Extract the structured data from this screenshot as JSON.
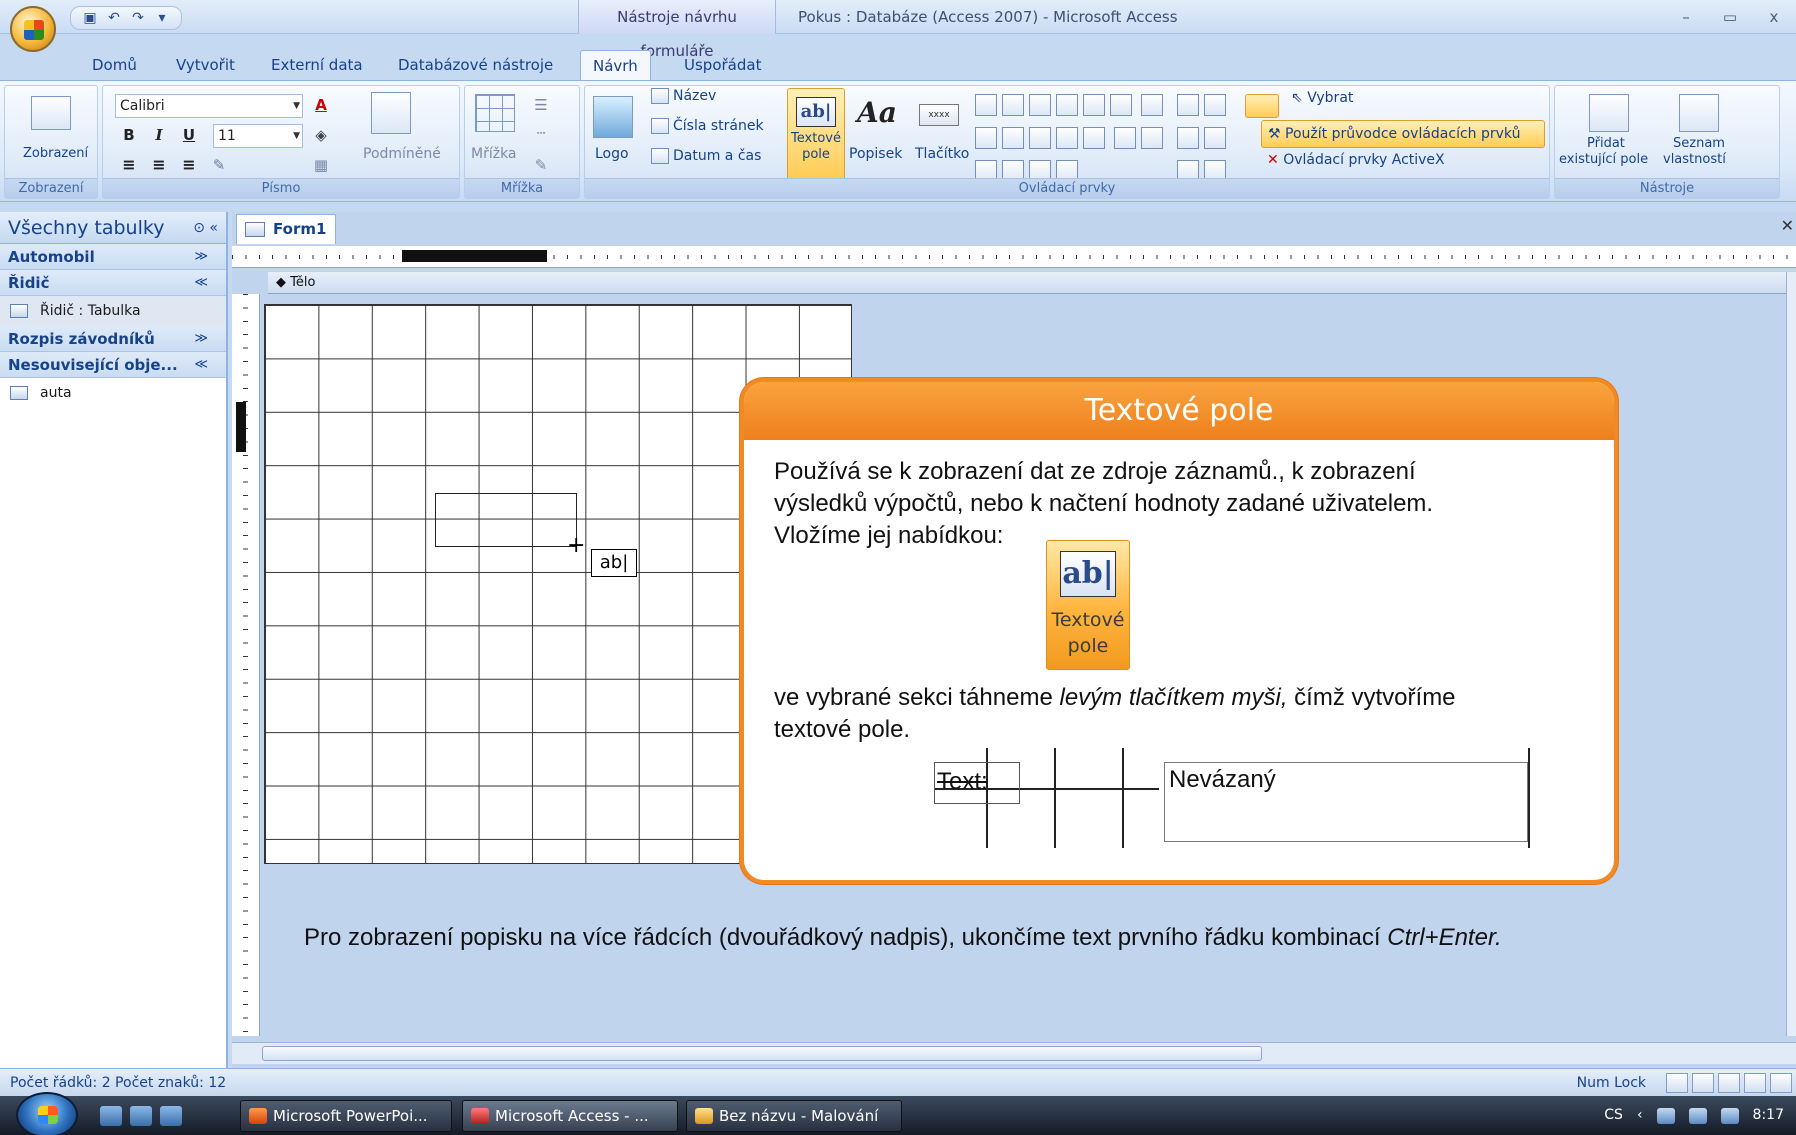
{
  "titlebar": {
    "context_tab_title": "Nástroje návrhu formuláře",
    "app_title": "Pokus : Databáze (Access 2007) - Microsoft Access",
    "minimize": "–",
    "maximize": "▭",
    "close": "x",
    "qat": {
      "save_icon": "floppy-icon",
      "undo_icon": "undo-icon",
      "redo_icon": "redo-icon",
      "customize_icon": "dropdown-icon"
    }
  },
  "ribbon_tabs": [
    "Domů",
    "Vytvořit",
    "Externí data",
    "Databázové nástroje",
    "Návrh",
    "Uspořádat"
  ],
  "ribbon": {
    "groups": {
      "zobrazeni": {
        "label": "Zobrazení",
        "button": "Zobrazení"
      },
      "pismo": {
        "label": "Písmo",
        "font": "Calibri",
        "size": "11",
        "bold": "B",
        "italic": "I",
        "underline": "U",
        "conditional": "Podmíněné"
      },
      "mrizka": {
        "label": "Mřížka",
        "button": "Mřížka"
      },
      "controls": {
        "label": "Ovládací prvky",
        "logo": "Logo",
        "nazev": "Název",
        "cisla_stranek": "Čísla stránek",
        "datum_cas": "Datum a čas",
        "textove_pole_l1": "Textové",
        "textove_pole_l2": "pole",
        "textbox_glyph": "ab|",
        "popisek": "Popisek",
        "popisek_glyph": "Aa",
        "tlacitko": "Tlačítko",
        "tlacitko_glyph": "xxxx",
        "vybrat": "Vybrat",
        "pruvodce": "Použít průvodce ovládacích prvků",
        "activex": "Ovládací prvky ActiveX"
      },
      "nastroje": {
        "label": "Nástroje",
        "pridat_l1": "Přidat",
        "pridat_l2": "existující pole",
        "seznam_l1": "Seznam",
        "seznam_l2": "vlastností"
      }
    }
  },
  "navpane": {
    "header": "Všechny tabulky",
    "groups": [
      {
        "label": "Automobil",
        "chevron": "≫"
      },
      {
        "label": "Řidič",
        "chevron": "≪",
        "items": [
          {
            "label": "Řidič : Tabulka"
          }
        ]
      },
      {
        "label": "Rozpis závodníků",
        "chevron": "≫"
      },
      {
        "label": "Nesouvisející obje...",
        "chevron": "≪",
        "items": [
          {
            "label": "auta"
          }
        ]
      }
    ]
  },
  "document": {
    "tab": "Form1",
    "section": "Tělo",
    "cursor_label": "ab|"
  },
  "callout": {
    "title": "Textové pole",
    "line1": "Používá se k zobrazení dat ze zdroje záznamů., k zobrazení",
    "line2": "výsledků výpočtů, nebo k načtení  hodnoty zadané uživatelem.",
    "line3": "Vložíme jej nabídkou:",
    "icon_glyph": "ab|",
    "icon_label_l1": "Textové",
    "icon_label_l2": "pole",
    "line4_a": "ve vybrané sekci táhneme ",
    "line4_b": "levým tlačítkem myši,",
    "line4_c": " čímž vytvoříme",
    "line5": "textové pole.",
    "fig_label": "Text:",
    "fig_field": "Nevázaný"
  },
  "note": {
    "text_a": "Pro zobrazení popisku na více řádcích (dvouřádkový nadpis), ukončíme text prvního řádku kombinací ",
    "text_b": "Ctrl+Enter."
  },
  "statusbar": {
    "left": "Počet řádků: 2 Počet znaků: 12",
    "numlock": "Num Lock"
  },
  "taskbar": {
    "tasks": [
      "Microsoft PowerPoi...",
      "Microsoft Access - ...",
      "Bez názvu - Malování"
    ],
    "lang": "CS",
    "time": "8:17"
  }
}
